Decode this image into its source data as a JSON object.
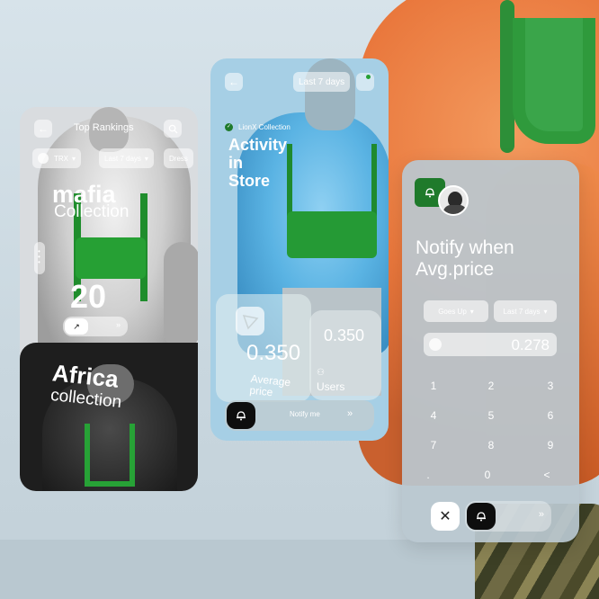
{
  "phone1": {
    "title": "Top Rankings",
    "chips": [
      "TRX",
      "Last 7 days",
      "Dress"
    ],
    "collection_name": "mafia",
    "collection_label": "Collection",
    "rank_value": "20",
    "card2_title": "Africa",
    "card2_subtitle": "collection"
  },
  "phone2": {
    "range_label": "Last 7 days",
    "brand_label": "LionX Collection",
    "title_line1": "Activity",
    "title_line2": "in",
    "title_line3": "Store",
    "avg_value": "0.350",
    "avg_label_1": "Average",
    "avg_label_2": "price",
    "users_value": "0.350",
    "users_label": "Users",
    "cta_label": "Notify me"
  },
  "phone3": {
    "title_line1": "Notify when",
    "title_line2": "Avg.price",
    "option1": "Goes Up",
    "option2": "Last 7 days",
    "price_value": "0.278",
    "keys": [
      "1",
      "2",
      "3",
      "4",
      "5",
      "6",
      "7",
      "8",
      "9",
      ".",
      "0",
      "<"
    ]
  },
  "colors": {
    "brand_green": "#1f7a2b",
    "accent_green": "#26a034",
    "dark": "#0e0e0e"
  },
  "icons": [
    "back-arrow-icon",
    "search-icon",
    "bell-icon",
    "close-icon",
    "chevron-double-right-icon",
    "tron-icon",
    "users-icon",
    "check-circle-icon",
    "trend-arrow-icon",
    "dots-icon"
  ]
}
